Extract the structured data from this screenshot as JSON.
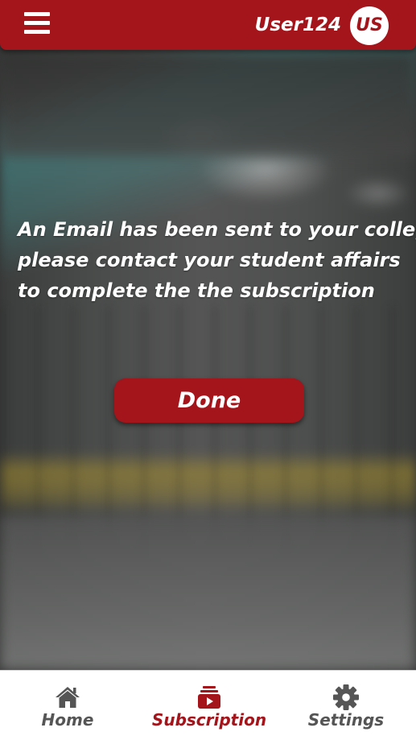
{
  "header": {
    "username": "User124",
    "avatar_initials": "US",
    "menu_icon": "hamburger-menu-icon"
  },
  "message": {
    "lines": [
      "An Email has been sent to your college",
      "please contact your student affairs",
      "to complete the the subscription"
    ]
  },
  "done_button": {
    "label": "Done"
  },
  "bottom_nav": {
    "items": [
      {
        "label": "Home",
        "icon": "home-icon",
        "active": false
      },
      {
        "label": "Subscription",
        "icon": "subscription-icon",
        "active": true
      },
      {
        "label": "Settings",
        "icon": "gear-icon",
        "active": false
      }
    ]
  },
  "colors": {
    "brand": "#a3141b",
    "nav_inactive": "#555555",
    "text_light": "#ffffff"
  }
}
